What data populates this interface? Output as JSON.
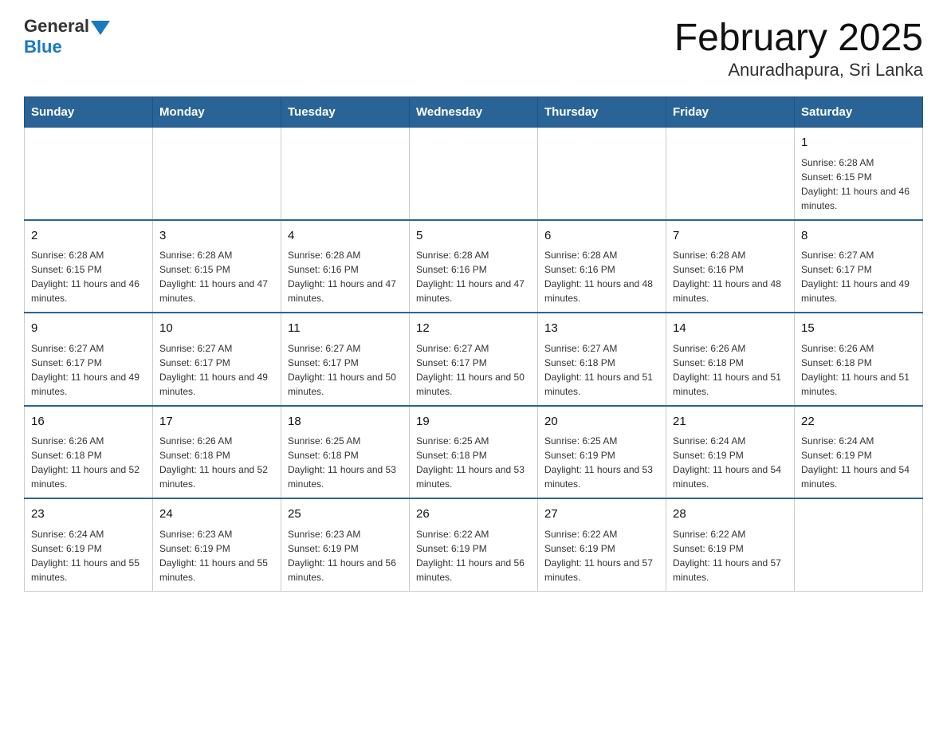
{
  "header": {
    "logo_general": "General",
    "logo_blue": "Blue",
    "month_title": "February 2025",
    "location": "Anuradhapura, Sri Lanka"
  },
  "days_of_week": [
    "Sunday",
    "Monday",
    "Tuesday",
    "Wednesday",
    "Thursday",
    "Friday",
    "Saturday"
  ],
  "weeks": [
    [
      {
        "day": "",
        "info": ""
      },
      {
        "day": "",
        "info": ""
      },
      {
        "day": "",
        "info": ""
      },
      {
        "day": "",
        "info": ""
      },
      {
        "day": "",
        "info": ""
      },
      {
        "day": "",
        "info": ""
      },
      {
        "day": "1",
        "info": "Sunrise: 6:28 AM\nSunset: 6:15 PM\nDaylight: 11 hours and 46 minutes."
      }
    ],
    [
      {
        "day": "2",
        "info": "Sunrise: 6:28 AM\nSunset: 6:15 PM\nDaylight: 11 hours and 46 minutes."
      },
      {
        "day": "3",
        "info": "Sunrise: 6:28 AM\nSunset: 6:15 PM\nDaylight: 11 hours and 47 minutes."
      },
      {
        "day": "4",
        "info": "Sunrise: 6:28 AM\nSunset: 6:16 PM\nDaylight: 11 hours and 47 minutes."
      },
      {
        "day": "5",
        "info": "Sunrise: 6:28 AM\nSunset: 6:16 PM\nDaylight: 11 hours and 47 minutes."
      },
      {
        "day": "6",
        "info": "Sunrise: 6:28 AM\nSunset: 6:16 PM\nDaylight: 11 hours and 48 minutes."
      },
      {
        "day": "7",
        "info": "Sunrise: 6:28 AM\nSunset: 6:16 PM\nDaylight: 11 hours and 48 minutes."
      },
      {
        "day": "8",
        "info": "Sunrise: 6:27 AM\nSunset: 6:17 PM\nDaylight: 11 hours and 49 minutes."
      }
    ],
    [
      {
        "day": "9",
        "info": "Sunrise: 6:27 AM\nSunset: 6:17 PM\nDaylight: 11 hours and 49 minutes."
      },
      {
        "day": "10",
        "info": "Sunrise: 6:27 AM\nSunset: 6:17 PM\nDaylight: 11 hours and 49 minutes."
      },
      {
        "day": "11",
        "info": "Sunrise: 6:27 AM\nSunset: 6:17 PM\nDaylight: 11 hours and 50 minutes."
      },
      {
        "day": "12",
        "info": "Sunrise: 6:27 AM\nSunset: 6:17 PM\nDaylight: 11 hours and 50 minutes."
      },
      {
        "day": "13",
        "info": "Sunrise: 6:27 AM\nSunset: 6:18 PM\nDaylight: 11 hours and 51 minutes."
      },
      {
        "day": "14",
        "info": "Sunrise: 6:26 AM\nSunset: 6:18 PM\nDaylight: 11 hours and 51 minutes."
      },
      {
        "day": "15",
        "info": "Sunrise: 6:26 AM\nSunset: 6:18 PM\nDaylight: 11 hours and 51 minutes."
      }
    ],
    [
      {
        "day": "16",
        "info": "Sunrise: 6:26 AM\nSunset: 6:18 PM\nDaylight: 11 hours and 52 minutes."
      },
      {
        "day": "17",
        "info": "Sunrise: 6:26 AM\nSunset: 6:18 PM\nDaylight: 11 hours and 52 minutes."
      },
      {
        "day": "18",
        "info": "Sunrise: 6:25 AM\nSunset: 6:18 PM\nDaylight: 11 hours and 53 minutes."
      },
      {
        "day": "19",
        "info": "Sunrise: 6:25 AM\nSunset: 6:18 PM\nDaylight: 11 hours and 53 minutes."
      },
      {
        "day": "20",
        "info": "Sunrise: 6:25 AM\nSunset: 6:19 PM\nDaylight: 11 hours and 53 minutes."
      },
      {
        "day": "21",
        "info": "Sunrise: 6:24 AM\nSunset: 6:19 PM\nDaylight: 11 hours and 54 minutes."
      },
      {
        "day": "22",
        "info": "Sunrise: 6:24 AM\nSunset: 6:19 PM\nDaylight: 11 hours and 54 minutes."
      }
    ],
    [
      {
        "day": "23",
        "info": "Sunrise: 6:24 AM\nSunset: 6:19 PM\nDaylight: 11 hours and 55 minutes."
      },
      {
        "day": "24",
        "info": "Sunrise: 6:23 AM\nSunset: 6:19 PM\nDaylight: 11 hours and 55 minutes."
      },
      {
        "day": "25",
        "info": "Sunrise: 6:23 AM\nSunset: 6:19 PM\nDaylight: 11 hours and 56 minutes."
      },
      {
        "day": "26",
        "info": "Sunrise: 6:22 AM\nSunset: 6:19 PM\nDaylight: 11 hours and 56 minutes."
      },
      {
        "day": "27",
        "info": "Sunrise: 6:22 AM\nSunset: 6:19 PM\nDaylight: 11 hours and 57 minutes."
      },
      {
        "day": "28",
        "info": "Sunrise: 6:22 AM\nSunset: 6:19 PM\nDaylight: 11 hours and 57 minutes."
      },
      {
        "day": "",
        "info": ""
      }
    ]
  ]
}
